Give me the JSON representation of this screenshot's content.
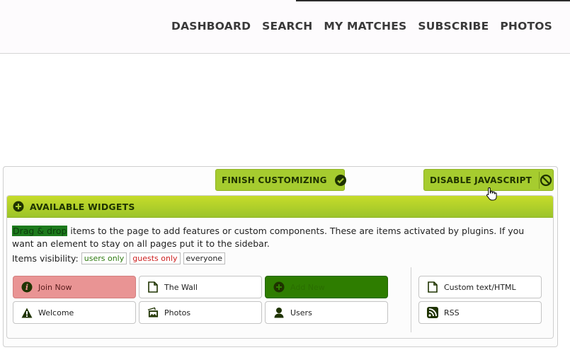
{
  "nav": {
    "items": [
      "DASHBOARD",
      "SEARCH",
      "MY MATCHES",
      "SUBSCRIBE",
      "PHOTOS"
    ]
  },
  "toolbar": {
    "finish_label": "FINISH CUSTOMIZING",
    "disable_js_label": "DISABLE JAVASCRIPT"
  },
  "widgets_panel": {
    "title": "AVAILABLE WIDGETS",
    "highlight_text": "Drag & drop",
    "description": " items to the page to add features or custom components. These are items activated by plugins. If you want an element to stay on all pages put it to the sidebar.",
    "visibility_label": "Items visibility:",
    "visibility_tags": [
      "users only",
      "guests only",
      "everyone"
    ],
    "widgets": [
      {
        "label": "Join Now",
        "icon": "info-icon"
      },
      {
        "label": "The Wall",
        "icon": "document-icon"
      },
      {
        "label": "Add New",
        "icon": "plus-circle-icon"
      },
      {
        "label": "Welcome",
        "icon": "warning-icon"
      },
      {
        "label": "Photos",
        "icon": "photos-icon"
      },
      {
        "label": "Users",
        "icon": "user-icon"
      },
      {
        "label": "Custom text/HTML",
        "icon": "document-icon"
      },
      {
        "label": "RSS",
        "icon": "rss-icon"
      }
    ]
  },
  "colors": {
    "accent_green": "#a6cc2f",
    "dark_green": "#1f3300",
    "join_pink": "#e99494",
    "addnew_green": "#2e7d00"
  }
}
